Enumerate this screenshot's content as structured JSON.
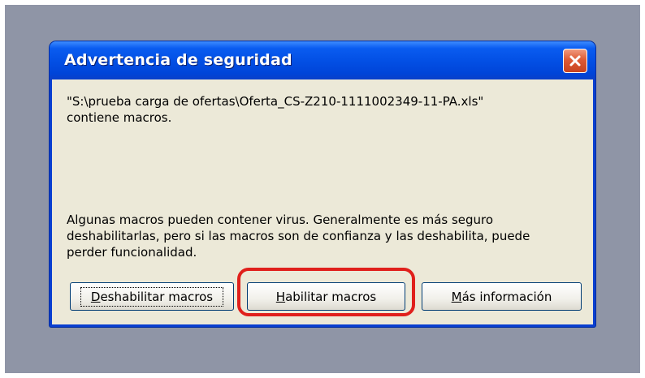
{
  "dialog": {
    "title": "Advertencia de seguridad",
    "file_path": "\"S:\\prueba carga de ofertas\\Oferta_CS-Z210-1111002349-11-PA.xls\"",
    "contains_macros": "contiene macros.",
    "warning_line1": "Algunas macros pueden contener virus. Generalmente es más seguro",
    "warning_line2": "deshabilitarlas, pero si las macros son de confianza y las deshabilita, puede",
    "warning_line3": "perder funcionalidad.",
    "buttons": {
      "disable_mnemonic": "D",
      "disable_rest": "eshabilitar macros",
      "enable_mnemonic": "H",
      "enable_rest": "abilitar macros",
      "info_mnemonic": "M",
      "info_rest": "ás información"
    },
    "close_icon": "close-icon"
  },
  "colors": {
    "desktop": "#8f95a6",
    "titlebar": "#0350e5",
    "dialog_bg": "#ece9d8",
    "highlight": "#e0201c",
    "close_button": "#de5a35"
  }
}
